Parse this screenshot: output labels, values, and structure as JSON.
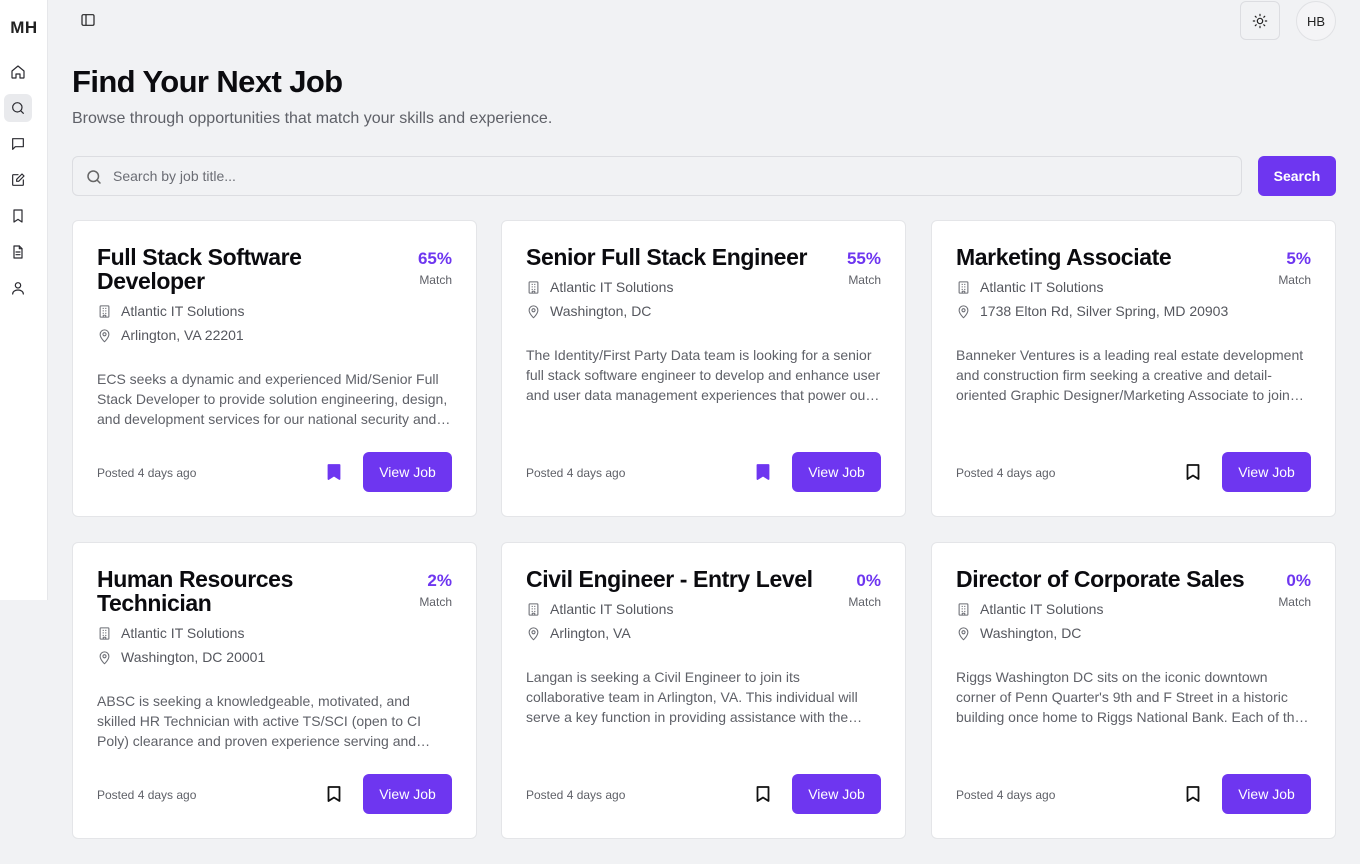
{
  "sidebar": {
    "logo": "MH",
    "items": [
      {
        "name": "home",
        "icon": "home-icon"
      },
      {
        "name": "search",
        "icon": "search-icon",
        "active": true
      },
      {
        "name": "messages",
        "icon": "message-icon"
      },
      {
        "name": "applications",
        "icon": "edit-icon"
      },
      {
        "name": "saved",
        "icon": "bookmark-icon"
      },
      {
        "name": "documents",
        "icon": "document-icon"
      },
      {
        "name": "profile",
        "icon": "user-icon"
      }
    ]
  },
  "header": {
    "avatar_initials": "HB",
    "theme_icon": "sun-icon",
    "toggle_icon": "sidebar-toggle-icon"
  },
  "page": {
    "title": "Find Your Next Job",
    "subtitle": "Browse through opportunities that match your skills and experience."
  },
  "search": {
    "placeholder": "Search by job title...",
    "value": "",
    "button_label": "Search"
  },
  "colors": {
    "accent": "#6e36f0",
    "background": "#f1f2f4",
    "card": "#ffffff"
  },
  "jobs": [
    {
      "title": "Full Stack Software Developer",
      "match_pct": "65%",
      "match_label": "Match",
      "company": "Atlantic IT Solutions",
      "location": "Arlington, VA 22201",
      "description": "ECS seeks a dynamic and experienced Mid/Senior Full Stack Developer to provide solution engineering, design, and development services for our national security and federal civilian customers.",
      "posted": "Posted 4 days ago",
      "saved": true,
      "button_label": "View Job"
    },
    {
      "title": "Senior Full Stack Engineer",
      "match_pct": "55%",
      "match_label": "Match",
      "company": "Atlantic IT Solutions",
      "location": "Washington, DC",
      "description": "The Identity/First Party Data team is looking for a senior full stack software engineer to develop and enhance user and user data management experiences that power our products.",
      "posted": "Posted 4 days ago",
      "saved": true,
      "button_label": "View Job"
    },
    {
      "title": "Marketing Associate",
      "match_pct": "5%",
      "match_label": "Match",
      "company": "Atlantic IT Solutions",
      "location": "1738 Elton Rd, Silver Spring, MD 20903",
      "description": "Banneker Ventures is a leading real estate development and construction firm seeking a creative and detail-oriented Graphic Designer/Marketing Associate to join our team.",
      "posted": "Posted 4 days ago",
      "saved": false,
      "button_label": "View Job"
    },
    {
      "title": "Human Resources Technician",
      "match_pct": "2%",
      "match_label": "Match",
      "company": "Atlantic IT Solutions",
      "location": "Washington, DC 20001",
      "description": "ABSC is seeking a knowledgeable, motivated, and skilled HR Technician with active TS/SCI (open to CI Poly) clearance and proven experience serving and supporting federal customers.",
      "posted": "Posted 4 days ago",
      "saved": false,
      "button_label": "View Job"
    },
    {
      "title": "Civil Engineer - Entry Level",
      "match_pct": "0%",
      "match_label": "Match",
      "company": "Atlantic IT Solutions",
      "location": "Arlington, VA",
      "description": "Langan is seeking a Civil Engineer to join its collaborative team in Arlington, VA. This individual will serve a key function in providing assistance with the design of land development projects.",
      "posted": "Posted 4 days ago",
      "saved": false,
      "button_label": "View Job"
    },
    {
      "title": "Director of Corporate Sales",
      "match_pct": "0%",
      "match_label": "Match",
      "company": "Atlantic IT Solutions",
      "location": "Washington, DC",
      "description": "Riggs Washington DC sits on the iconic downtown corner of Penn Quarter's 9th and F Street in a historic building once home to Riggs National Bank. Each of the rooms is thoughtfully designed.",
      "posted": "Posted 4 days ago",
      "saved": false,
      "button_label": "View Job"
    }
  ]
}
